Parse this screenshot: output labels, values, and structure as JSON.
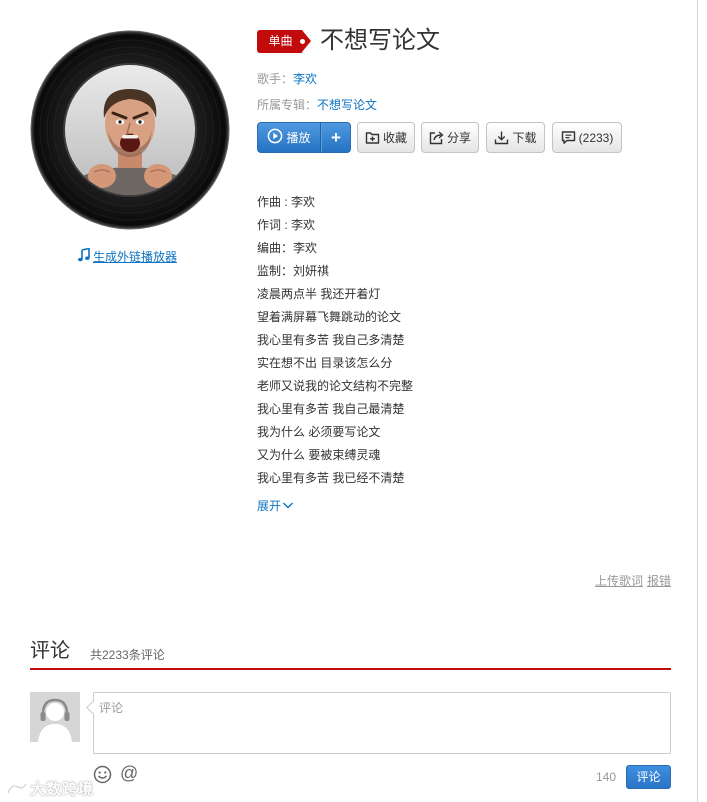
{
  "song": {
    "badge": "单曲",
    "title": "不想写论文",
    "artist_label": "歌手：",
    "artist": "李欢",
    "album_label": "所属专辑：",
    "album": "不想写论文"
  },
  "cover": {
    "ext_link_label": "生成外链播放器"
  },
  "actions": {
    "play": "播放",
    "add": "+",
    "collect": "收藏",
    "share": "分享",
    "download": "下载",
    "comment": "(2233)"
  },
  "lyrics": {
    "lines": [
      "作曲 : 李欢",
      "作词 : 李欢",
      "编曲：李欢",
      "监制：刘妍祺",
      "凌晨两点半 我还开着灯",
      "望着满屏幕飞舞跳动的论文",
      "我心里有多苦 我自己多清楚",
      "实在想不出 目录该怎么分",
      "老师又说我的论文结构不完整",
      "我心里有多苦 我自己最清楚",
      "我为什么 必须要写论文",
      "又为什么 要被束缚灵魂",
      "我心里有多苦 我已经不清楚"
    ],
    "expand": "展开",
    "upload": "上传歌词",
    "report": "报错"
  },
  "comments": {
    "title": "评论",
    "count_text": "共2233条评论",
    "placeholder": "评论",
    "mention_symbol": "@",
    "char_limit": "140",
    "submit": "评论"
  },
  "watermark": "大数跨境",
  "icons": {
    "ext_link": "music-note-icon",
    "play": "play-circle-icon",
    "collect": "folder-plus-icon",
    "share": "share-icon",
    "download": "download-icon",
    "comment": "comment-bubble-icon",
    "expand": "chevron-down-icon",
    "emoji": "emoji-icon"
  },
  "colors": {
    "accent_red": "#c20c0c",
    "link_blue": "#0c73c2",
    "button_blue": "#2f7ed1",
    "muted_text": "#999999"
  }
}
